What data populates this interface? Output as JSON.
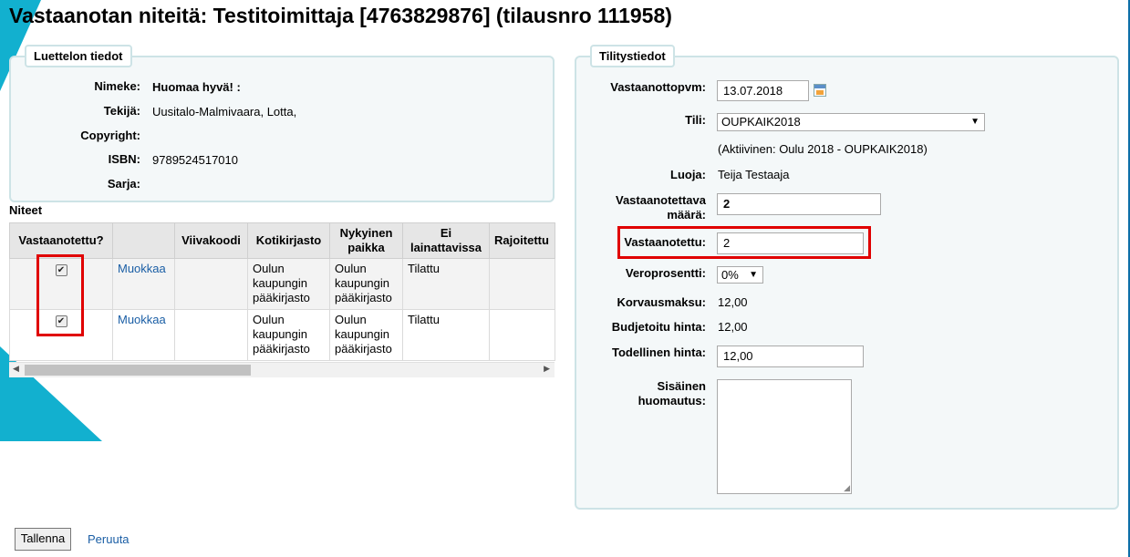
{
  "title": "Vastaanotan niteitä: Testitoimittaja [4763829876] (tilausnro 111958)",
  "catalog": {
    "legend": "Luettelon tiedot",
    "fields": [
      {
        "label": "Nimeke:",
        "value": "Huomaa hyvä! :"
      },
      {
        "label": "Tekijä:",
        "value": "Uusitalo-Malmivaara, Lotta,"
      },
      {
        "label": "Copyright:",
        "value": ""
      },
      {
        "label": "ISBN:",
        "value": "9789524517010"
      },
      {
        "label": "Sarja:",
        "value": ""
      }
    ]
  },
  "items": {
    "heading": "Niteet",
    "columns": [
      "Vastaanotettu?",
      "",
      "Viivakoodi",
      "Kotikirjasto",
      "Nykyinen paikka",
      "Ei lainattavissa",
      "Rajoitettu"
    ],
    "rows": [
      {
        "checked": true,
        "edit": "Muokkaa",
        "barcode": "",
        "home": "Oulun kaupungin pääkirjasto",
        "current": "Oulun kaupungin pääkirjasto",
        "notforloan": "Tilattu",
        "restricted": ""
      },
      {
        "checked": true,
        "edit": "Muokkaa",
        "barcode": "",
        "home": "Oulun kaupungin pääkirjasto",
        "current": "Oulun kaupungin pääkirjasto",
        "notforloan": "Tilattu",
        "restricted": ""
      }
    ]
  },
  "accounting": {
    "legend": "Tilitystiedot",
    "received_date_label": "Vastaanottopvm:",
    "received_date": "13.07.2018",
    "fund_label": "Tili:",
    "fund_value": "OUPKAIK2018",
    "fund_note": "(Aktiivinen: Oulu 2018 - OUPKAIK2018)",
    "creator_label": "Luoja:",
    "creator": "Teija Testaaja",
    "quantity_label": "Vastaanotettava määrä:",
    "quantity": "2",
    "received_label": "Vastaanotettu:",
    "received": "2",
    "tax_label": "Veroprosentti:",
    "tax_value": "0%",
    "replacement_label": "Korvausmaksu:",
    "replacement": "12,00",
    "budgeted_label": "Budjetoitu hinta:",
    "budgeted": "12,00",
    "actual_label": "Todellinen hinta:",
    "actual": "12,00",
    "note_label": "Sisäinen huomautus:",
    "note": ""
  },
  "actions": {
    "save": "Tallenna",
    "cancel": "Peruuta"
  },
  "colors": {
    "accent": "#12b0cf",
    "highlight": "#e00000",
    "link": "#1a5ea5"
  }
}
